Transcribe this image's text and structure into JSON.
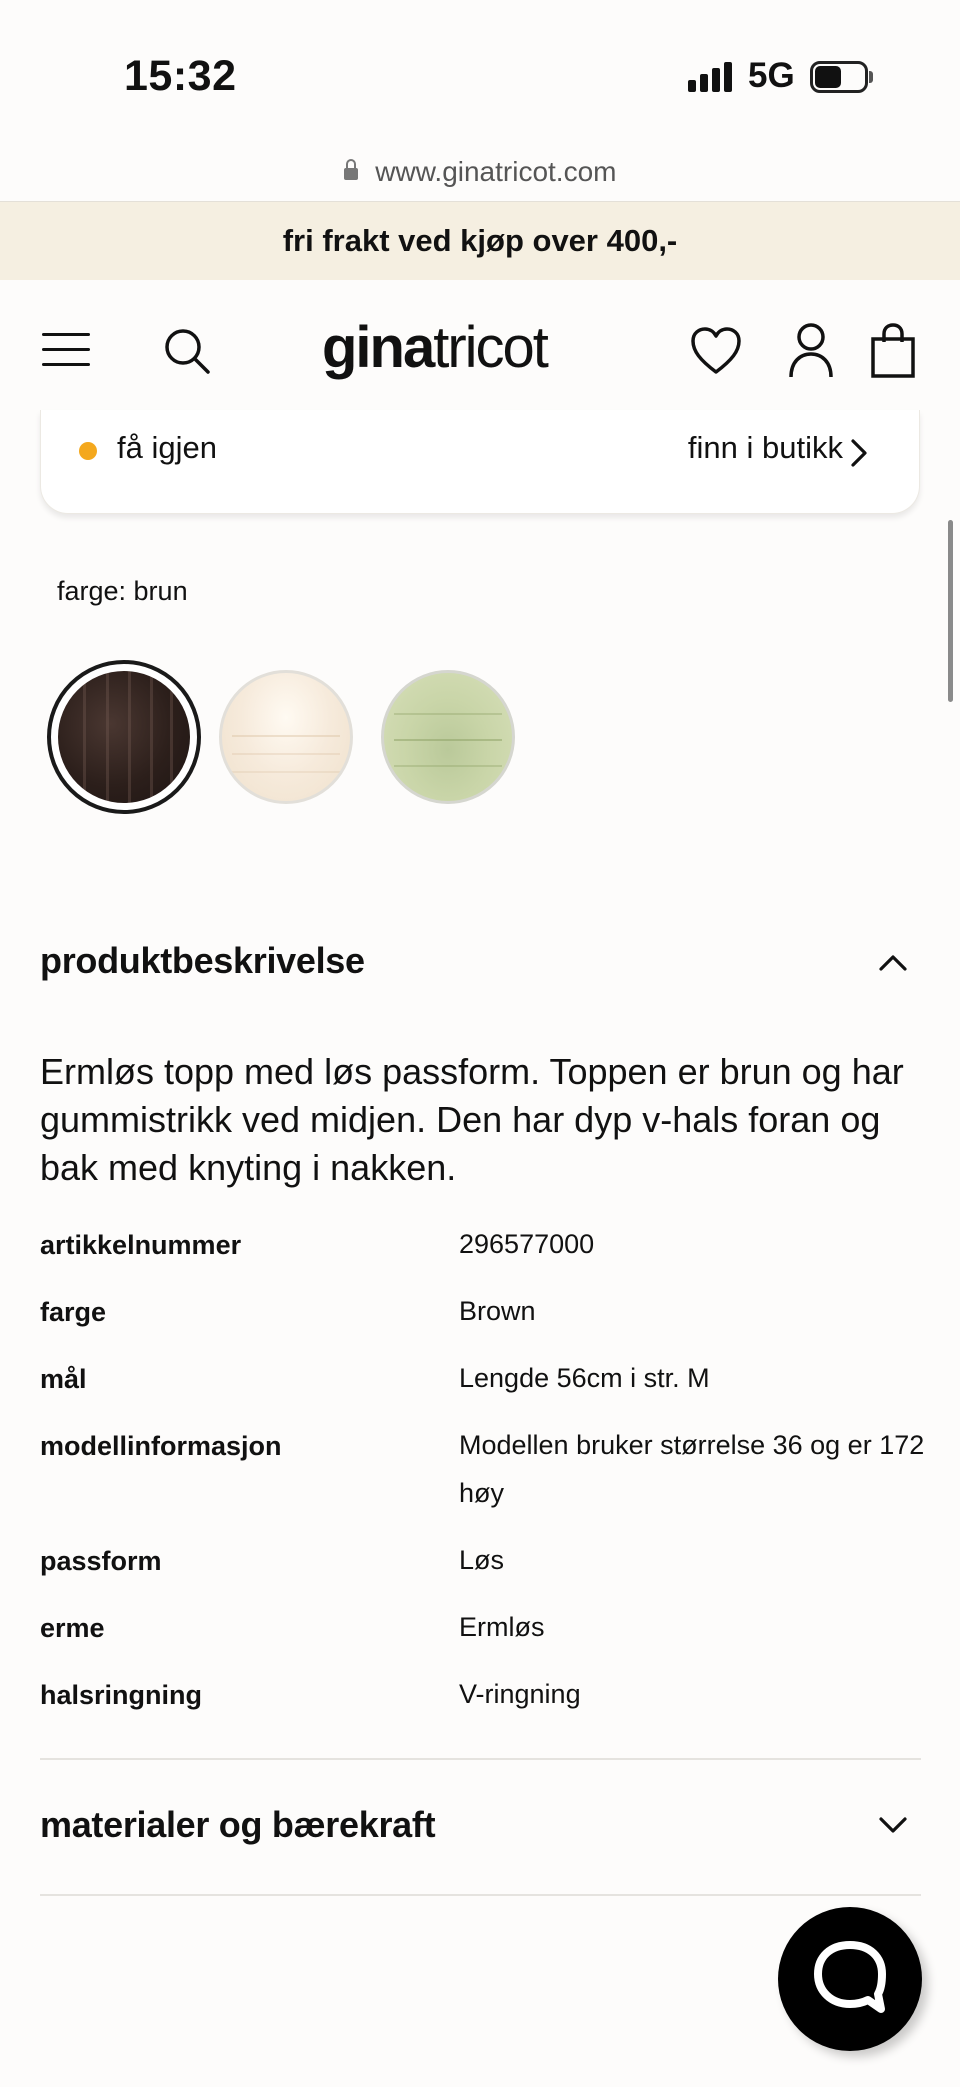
{
  "status_bar": {
    "time": "15:32",
    "network": "5G"
  },
  "browser": {
    "url": "www.ginatricot.com"
  },
  "promo": {
    "text": "fri frakt ved kjøp over 400,-"
  },
  "header": {
    "logo_bold": "gina",
    "logo_light": "tricot",
    "icons": [
      "menu-icon",
      "search-icon",
      "heart-icon",
      "user-icon",
      "bag-icon"
    ]
  },
  "availability": {
    "status": "få igjen",
    "status_color": "#f4a81d",
    "store_link": "finn i butikk"
  },
  "color_picker": {
    "label": "farge: brun",
    "swatches": [
      {
        "name": "brun",
        "color": "#2c1f1b",
        "selected": true
      },
      {
        "name": "offwhite",
        "color": "#f6eadb",
        "selected": false
      },
      {
        "name": "grønn",
        "color": "#c9d5a8",
        "selected": false
      }
    ]
  },
  "product_description": {
    "title": "produktbeskrivelse",
    "text": "Ermløs topp med løs passform. Toppen er brun og har gummistrikk ved midjen. Den har dyp v-hals foran og bak med knyting i nakken.",
    "specs": [
      {
        "key": "artikkelnummer",
        "value": "296577000"
      },
      {
        "key": "farge",
        "value": "Brown"
      },
      {
        "key": "mål",
        "value": "Lengde 56cm i str. M"
      },
      {
        "key": "modellinformasjon",
        "value": "Modellen bruker størrelse 36 og er 172 høy"
      },
      {
        "key": "passform",
        "value": "Løs"
      },
      {
        "key": "erme",
        "value": "Ermløs"
      },
      {
        "key": "halsringning",
        "value": "V-ringning"
      }
    ]
  },
  "materials": {
    "title": "materialer og bærekraft"
  }
}
